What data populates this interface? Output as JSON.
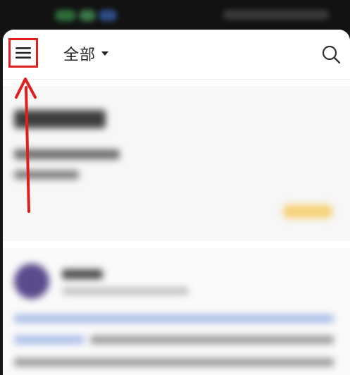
{
  "header": {
    "filter_label": "全部",
    "menu_icon": "hamburger-menu-icon",
    "search_icon": "search-icon",
    "dropdown_icon": "caret-down-icon"
  },
  "colors": {
    "highlight": "#e01e1e",
    "badge": "#f9d58a",
    "link_text": "#9fb6e6"
  }
}
